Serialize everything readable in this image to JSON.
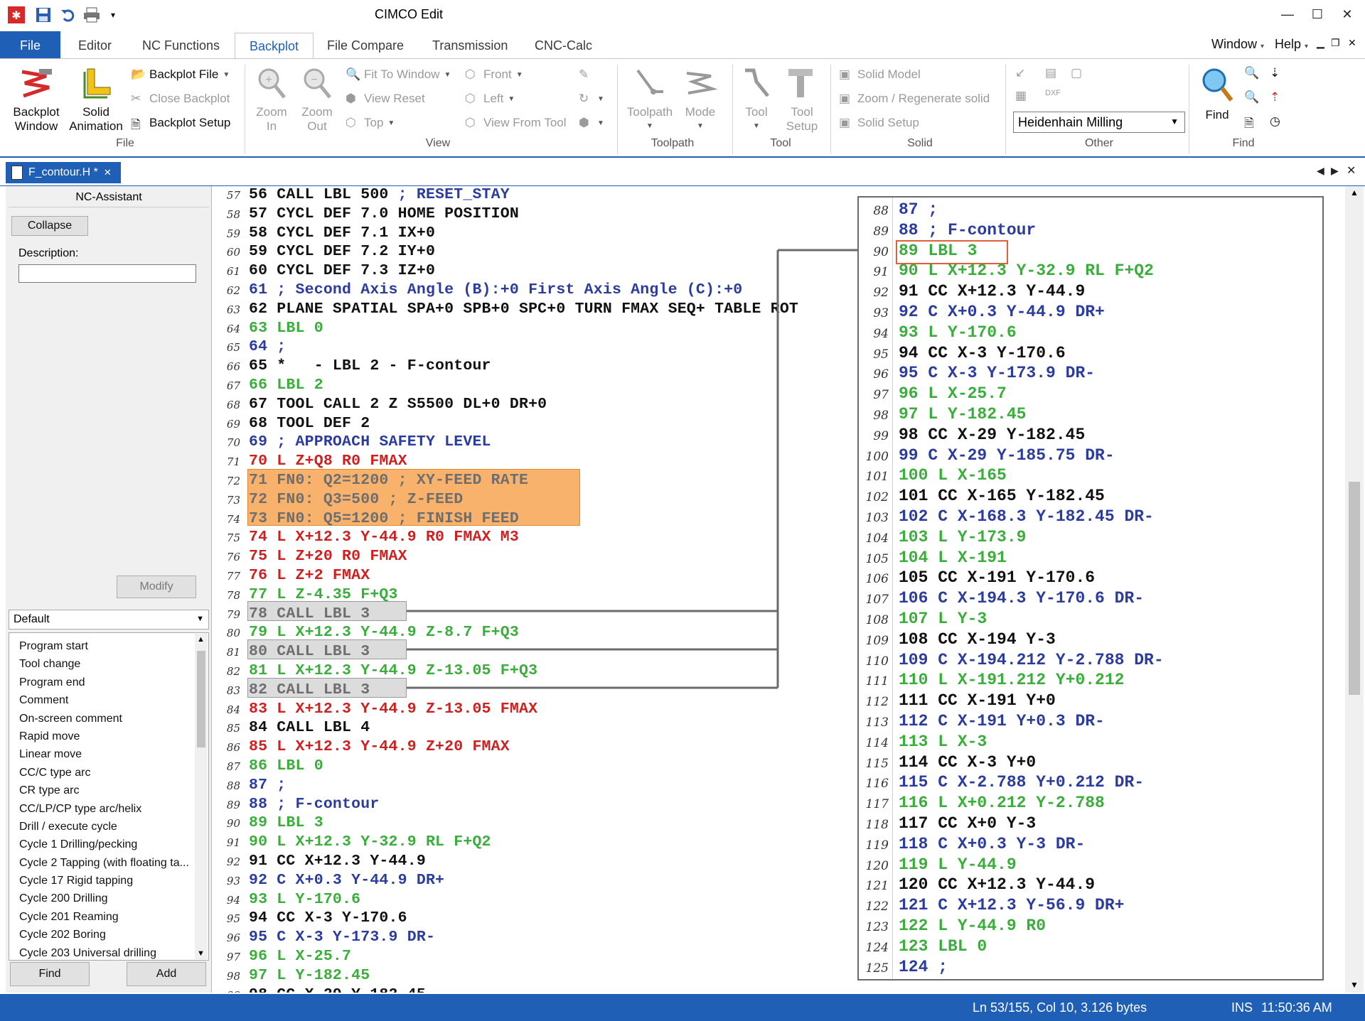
{
  "window": {
    "title": "CIMCO Edit"
  },
  "ribbon_tabs": [
    "File",
    "Editor",
    "NC Functions",
    "Backplot",
    "File Compare",
    "Transmission",
    "CNC-Calc"
  ],
  "menu_right": {
    "window": "Window",
    "help": "Help"
  },
  "file_group": {
    "label": "File",
    "backplot_window": [
      "Backplot",
      "Window"
    ],
    "solid_animation": [
      "Solid",
      "Animation"
    ],
    "backplot_file": "Backplot File",
    "close_backplot": "Close Backplot",
    "backplot_setup": "Backplot Setup"
  },
  "view_group": {
    "label": "View",
    "zoom_in": [
      "Zoom",
      "In"
    ],
    "zoom_out": [
      "Zoom",
      "Out"
    ],
    "fit_to_window": "Fit To Window",
    "view_reset": "View Reset",
    "top": "Top",
    "front": "Front",
    "left": "Left",
    "view_from_tool": "View From Tool"
  },
  "toolpath_group": {
    "label": "Toolpath",
    "toolpath": "Toolpath",
    "mode": "Mode"
  },
  "tool_group": {
    "label": "Tool",
    "tool": "Tool",
    "tool_setup": [
      "Tool",
      "Setup"
    ]
  },
  "solid_group": {
    "label": "Solid",
    "solid_model": "Solid Model",
    "zoom_regenerate": "Zoom / Regenerate solid",
    "solid_setup": "Solid Setup"
  },
  "other_group": {
    "label": "Other",
    "machine": "Heidenhain Milling"
  },
  "find_group": {
    "label": "Find",
    "find": "Find"
  },
  "doc_tab": {
    "name": "F_contour.H *",
    "close": "✕"
  },
  "nc_assistant": {
    "title": "NC-Assistant",
    "collapse": "Collapse",
    "description_label": "Description:",
    "description_value": "",
    "modify": "Modify",
    "preset": "Default",
    "items": [
      "Program start",
      "Tool change",
      "Program end",
      "Comment",
      "On-screen comment",
      "Rapid move",
      "Linear move",
      "CC/C type arc",
      "CR type arc",
      "CC/LP/CP type arc/helix",
      "Drill / execute cycle",
      "Cycle 1 Drilling/pecking",
      "Cycle 2 Tapping (with floating ta...",
      "Cycle 17 Rigid tapping",
      "Cycle 200 Drilling",
      "Cycle 201 Reaming",
      "Cycle 202 Boring",
      "Cycle 203 Universal drilling"
    ],
    "find": "Find",
    "add": "Add"
  },
  "editor_lines": [
    {
      "n": "57",
      "t": "56 CALL LBL 500 ; RESET_STAY",
      "c": "mixed_reset"
    },
    {
      "n": "58",
      "t": "57 CYCL DEF 7.0 HOME POSITION",
      "c": "black"
    },
    {
      "n": "59",
      "t": "58 CYCL DEF 7.1 IX+0",
      "c": "black"
    },
    {
      "n": "60",
      "t": "59 CYCL DEF 7.2 IY+0",
      "c": "black"
    },
    {
      "n": "61",
      "t": "60 CYCL DEF 7.3 IZ+0",
      "c": "black"
    },
    {
      "n": "62",
      "t": "61 ; Second Axis Angle (B):+0 First Axis Angle (C):+0",
      "c": "blue_comment"
    },
    {
      "n": "63",
      "t": "62 PLANE SPATIAL SPA+0 SPB+0 SPC+0 TURN FMAX SEQ+ TABLE ROT",
      "c": "black"
    },
    {
      "n": "64",
      "t": "63 LBL 0",
      "c": "green"
    },
    {
      "n": "65",
      "t": "64 ;",
      "c": "blue_comment"
    },
    {
      "n": "66",
      "t": "65 *   - LBL 2 - F-contour",
      "c": "black"
    },
    {
      "n": "67",
      "t": "66 LBL 2",
      "c": "green"
    },
    {
      "n": "68",
      "t": "67 TOOL CALL 2 Z S5500 DL+0 DR+0",
      "c": "black"
    },
    {
      "n": "69",
      "t": "68 TOOL DEF 2",
      "c": "black"
    },
    {
      "n": "70",
      "t": "69 ; APPROACH SAFETY LEVEL",
      "c": "blue_comment"
    },
    {
      "n": "71",
      "t": "70 L Z+Q8 R0 FMAX",
      "c": "red"
    },
    {
      "n": "72",
      "t": "71 FN0: Q2=1200 ; XY-FEED RATE",
      "c": "grey_fn"
    },
    {
      "n": "73",
      "t": "72 FN0: Q3=500 ; Z-FEED",
      "c": "grey_fn"
    },
    {
      "n": "74",
      "t": "73 FN0: Q5=1200 ; FINISH FEED",
      "c": "grey_fn"
    },
    {
      "n": "75",
      "t": "74 L X+12.3 Y-44.9 R0 FMAX M3",
      "c": "red"
    },
    {
      "n": "76",
      "t": "75 L Z+20 R0 FMAX",
      "c": "red"
    },
    {
      "n": "77",
      "t": "76 L Z+2 FMAX",
      "c": "red"
    },
    {
      "n": "78",
      "t": "77 L Z-4.35 F+Q3",
      "c": "green"
    },
    {
      "n": "79",
      "t": "78 CALL LBL 3",
      "c": "grey_call"
    },
    {
      "n": "80",
      "t": "79 L X+12.3 Y-44.9 Z-8.7 F+Q3",
      "c": "green"
    },
    {
      "n": "81",
      "t": "80 CALL LBL 3",
      "c": "grey_call"
    },
    {
      "n": "82",
      "t": "81 L X+12.3 Y-44.9 Z-13.05 F+Q3",
      "c": "green"
    },
    {
      "n": "83",
      "t": "82 CALL LBL 3",
      "c": "grey_call"
    },
    {
      "n": "84",
      "t": "83 L X+12.3 Y-44.9 Z-13.05 FMAX",
      "c": "red"
    },
    {
      "n": "85",
      "t": "84 CALL LBL 4",
      "c": "black"
    },
    {
      "n": "86",
      "t": "85 L X+12.3 Y-44.9 Z+20 FMAX",
      "c": "red"
    },
    {
      "n": "87",
      "t": "86 LBL 0",
      "c": "green"
    },
    {
      "n": "88",
      "t": "87 ;",
      "c": "blue_comment"
    },
    {
      "n": "89",
      "t": "88 ; F-contour",
      "c": "blue_comment"
    },
    {
      "n": "90",
      "t": "89 LBL 3",
      "c": "green"
    },
    {
      "n": "91",
      "t": "90 L X+12.3 Y-32.9 RL F+Q2",
      "c": "green"
    },
    {
      "n": "92",
      "t": "91 CC X+12.3 Y-44.9",
      "c": "black"
    },
    {
      "n": "93",
      "t": "92 C X+0.3 Y-44.9 DR+",
      "c": "blue"
    },
    {
      "n": "94",
      "t": "93 L Y-170.6",
      "c": "green"
    },
    {
      "n": "95",
      "t": "94 CC X-3 Y-170.6",
      "c": "black"
    },
    {
      "n": "96",
      "t": "95 C X-3 Y-173.9 DR-",
      "c": "blue"
    },
    {
      "n": "97",
      "t": "96 L X-25.7",
      "c": "green"
    },
    {
      "n": "98",
      "t": "97 L Y-182.45",
      "c": "green"
    },
    {
      "n": "99",
      "t": "98 CC X-29 Y-182.45",
      "c": "black"
    }
  ],
  "zoom_lines": [
    {
      "n": "88",
      "t": "87 ;",
      "c": "blue_comment"
    },
    {
      "n": "89",
      "t": "88 ; F-contour",
      "c": "blue_comment"
    },
    {
      "n": "90",
      "t": "89 LBL 3",
      "c": "green_boxed"
    },
    {
      "n": "91",
      "t": "90 L X+12.3 Y-32.9 RL F+Q2",
      "c": "green"
    },
    {
      "n": "92",
      "t": "91 CC X+12.3 Y-44.9",
      "c": "black"
    },
    {
      "n": "93",
      "t": "92 C X+0.3 Y-44.9 DR+",
      "c": "blue"
    },
    {
      "n": "94",
      "t": "93 L Y-170.6",
      "c": "green"
    },
    {
      "n": "95",
      "t": "94 CC X-3 Y-170.6",
      "c": "black"
    },
    {
      "n": "96",
      "t": "95 C X-3 Y-173.9 DR-",
      "c": "blue"
    },
    {
      "n": "97",
      "t": "96 L X-25.7",
      "c": "green"
    },
    {
      "n": "98",
      "t": "97 L Y-182.45",
      "c": "green"
    },
    {
      "n": "99",
      "t": "98 CC X-29 Y-182.45",
      "c": "black"
    },
    {
      "n": "100",
      "t": "99 C X-29 Y-185.75 DR-",
      "c": "blue"
    },
    {
      "n": "101",
      "t": "100 L X-165",
      "c": "green"
    },
    {
      "n": "102",
      "t": "101 CC X-165 Y-182.45",
      "c": "black"
    },
    {
      "n": "103",
      "t": "102 C X-168.3 Y-182.45 DR-",
      "c": "blue"
    },
    {
      "n": "104",
      "t": "103 L Y-173.9",
      "c": "green"
    },
    {
      "n": "105",
      "t": "104 L X-191",
      "c": "green"
    },
    {
      "n": "106",
      "t": "105 CC X-191 Y-170.6",
      "c": "black"
    },
    {
      "n": "107",
      "t": "106 C X-194.3 Y-170.6 DR-",
      "c": "blue"
    },
    {
      "n": "108",
      "t": "107 L Y-3",
      "c": "green"
    },
    {
      "n": "109",
      "t": "108 CC X-194 Y-3",
      "c": "black"
    },
    {
      "n": "110",
      "t": "109 C X-194.212 Y-2.788 DR-",
      "c": "blue"
    },
    {
      "n": "111",
      "t": "110 L X-191.212 Y+0.212",
      "c": "green"
    },
    {
      "n": "112",
      "t": "111 CC X-191 Y+0",
      "c": "black"
    },
    {
      "n": "113",
      "t": "112 C X-191 Y+0.3 DR-",
      "c": "blue"
    },
    {
      "n": "114",
      "t": "113 L X-3",
      "c": "green"
    },
    {
      "n": "115",
      "t": "114 CC X-3 Y+0",
      "c": "black"
    },
    {
      "n": "116",
      "t": "115 C X-2.788 Y+0.212 DR-",
      "c": "blue"
    },
    {
      "n": "117",
      "t": "116 L X+0.212 Y-2.788",
      "c": "green"
    },
    {
      "n": "118",
      "t": "117 CC X+0 Y-3",
      "c": "black"
    },
    {
      "n": "119",
      "t": "118 C X+0.3 Y-3 DR-",
      "c": "blue"
    },
    {
      "n": "120",
      "t": "119 L Y-44.9",
      "c": "green"
    },
    {
      "n": "121",
      "t": "120 CC X+12.3 Y-44.9",
      "c": "black"
    },
    {
      "n": "122",
      "t": "121 C X+12.3 Y-56.9 DR+",
      "c": "blue"
    },
    {
      "n": "123",
      "t": "122 L Y-44.9 R0",
      "c": "green"
    },
    {
      "n": "124",
      "t": "123 LBL 0",
      "c": "green"
    },
    {
      "n": "125",
      "t": "124 ;",
      "c": "blue_comment"
    }
  ],
  "status": {
    "position": "Ln 53/155, Col 10, 3.126 bytes",
    "mode": "INS",
    "time": "11:50:36 AM"
  },
  "colors": {
    "accent": "#1f5fb5",
    "green_code": "#3aae3a",
    "red_code": "#d01f1f",
    "blue_code": "#2b3c9e",
    "highlight_orange": "#f9b26b"
  }
}
